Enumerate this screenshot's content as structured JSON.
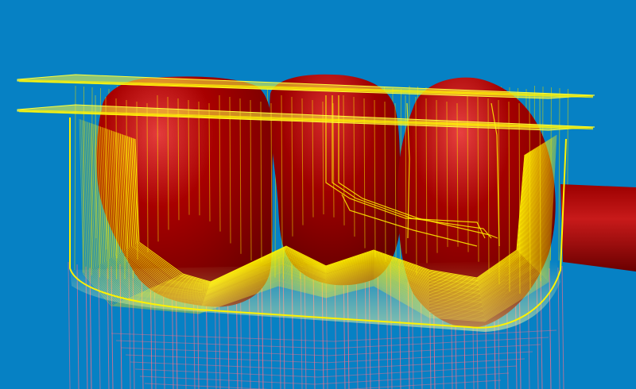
{
  "viewport": {
    "background_color": "#0681c4"
  },
  "model": {
    "teeth": [
      {
        "id": "tooth-left"
      },
      {
        "id": "tooth-middle"
      },
      {
        "id": "tooth-right"
      }
    ],
    "connector": {
      "id": "connector-bar"
    },
    "colors": {
      "tooth_fill": "#9a0000",
      "tooth_highlight": "#e13a3a",
      "tooth_shadow": "#5e0000"
    }
  },
  "toolpath": {
    "colors": {
      "cutting": "#fff200",
      "cutting_dim": "#d9d200",
      "rapid": "#ff6f8a",
      "plane": "#ffff3a"
    },
    "layers": {
      "clearance_planes": 2,
      "front_passes": 46,
      "plunge_lines": 60
    }
  }
}
